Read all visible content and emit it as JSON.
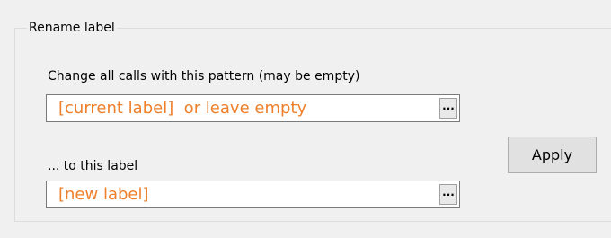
{
  "group": {
    "title": "Rename label"
  },
  "pattern": {
    "label": "Change all calls with this pattern (may be empty)",
    "value": "[current label]  or leave empty",
    "browse_label": "..."
  },
  "new_label": {
    "label": "... to this label",
    "value": "[new label]",
    "browse_label": "..."
  },
  "apply_button": {
    "label": "Apply"
  },
  "colors": {
    "placeholder_text": "#ef7f2a",
    "background": "#f0f0f0"
  }
}
